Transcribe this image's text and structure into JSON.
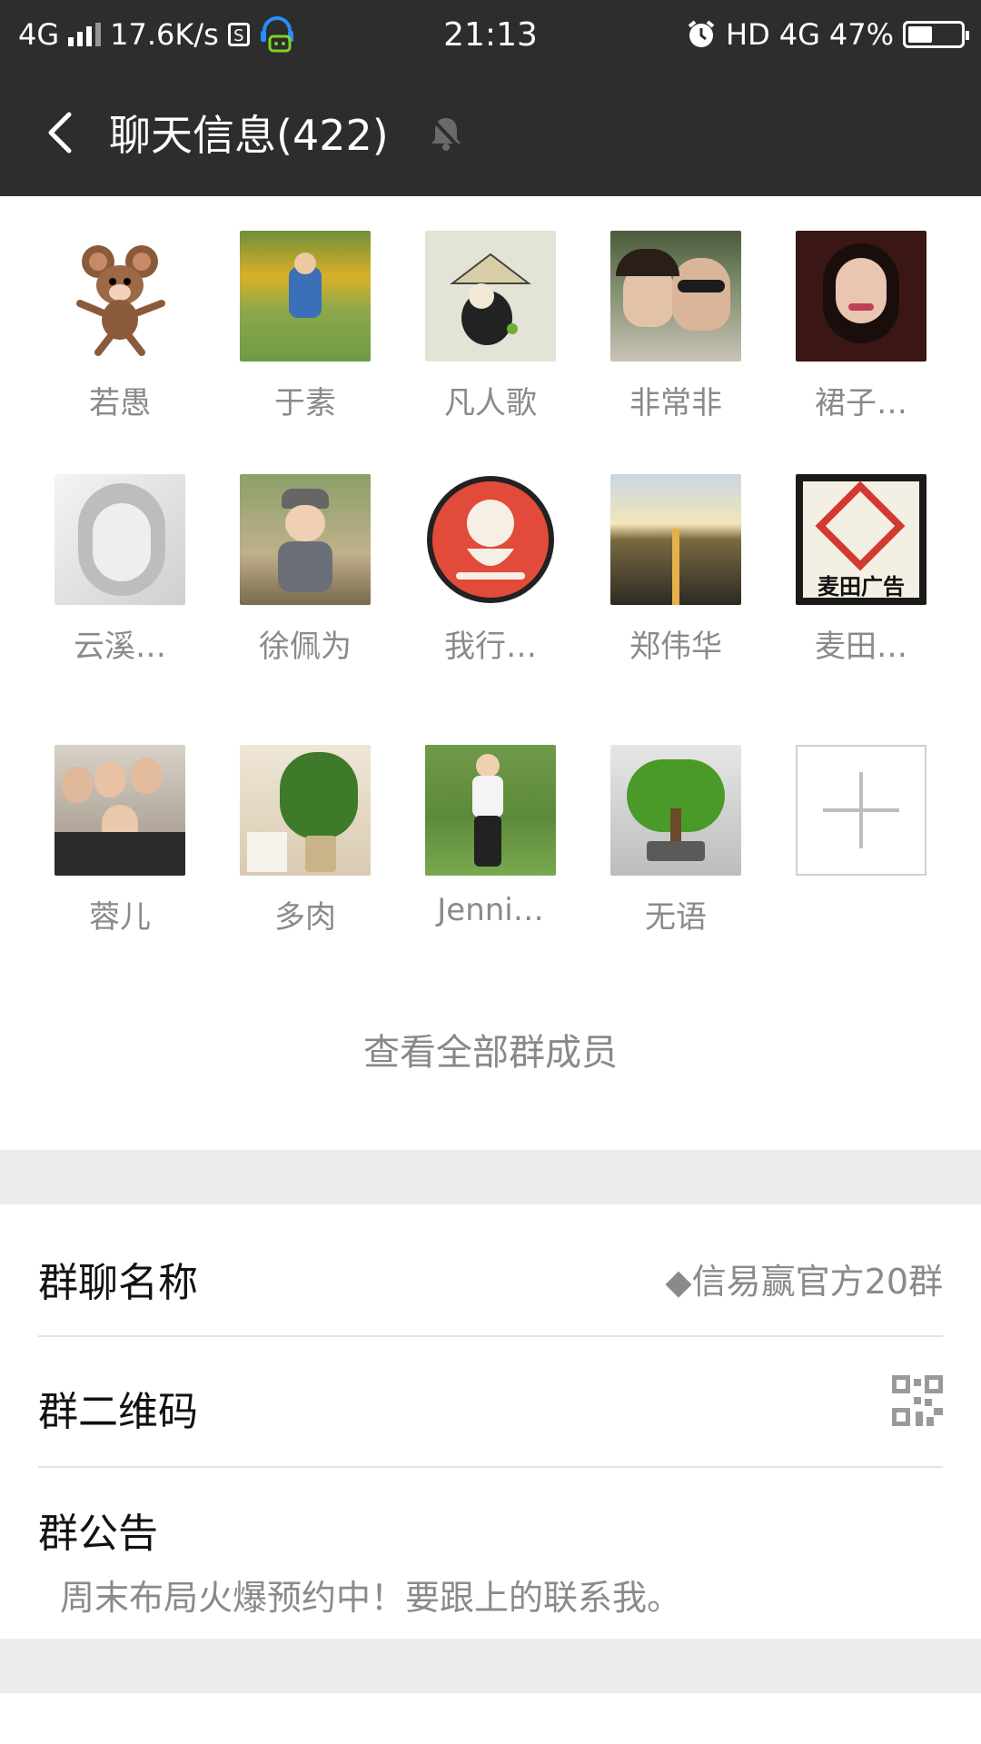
{
  "status_bar": {
    "network": "4G",
    "speed": "17.6K/s",
    "sim_badge": "S",
    "time": "21:13",
    "hd": "HD",
    "network_right": "4G",
    "battery": "47%",
    "battery_level": 0.47
  },
  "header": {
    "title": "聊天信息(422)",
    "back_icon": "chevron-left-icon",
    "mute_icon": "bell-muted-icon"
  },
  "members": [
    {
      "name": "若愚"
    },
    {
      "name": "于素"
    },
    {
      "name": "凡人歌"
    },
    {
      "name": "非常非"
    },
    {
      "name": "裙子…"
    },
    {
      "name": "云溪…"
    },
    {
      "name": "徐佩为"
    },
    {
      "name": "我行…"
    },
    {
      "name": "郑伟华"
    },
    {
      "name": "麦田…",
      "avatar_text": "麦田广告"
    },
    {
      "name": "蓉儿"
    },
    {
      "name": "多肉"
    },
    {
      "name": "Jenni…"
    },
    {
      "name": "无语"
    }
  ],
  "view_all_label": "查看全部群成员",
  "settings": {
    "group_name": {
      "label": "群聊名称",
      "value": "◆信易赢官方20群"
    },
    "group_qr": {
      "label": "群二维码"
    },
    "announcement": {
      "label": "群公告",
      "text": "周末布局火爆预约中！要跟上的联系我。"
    }
  }
}
